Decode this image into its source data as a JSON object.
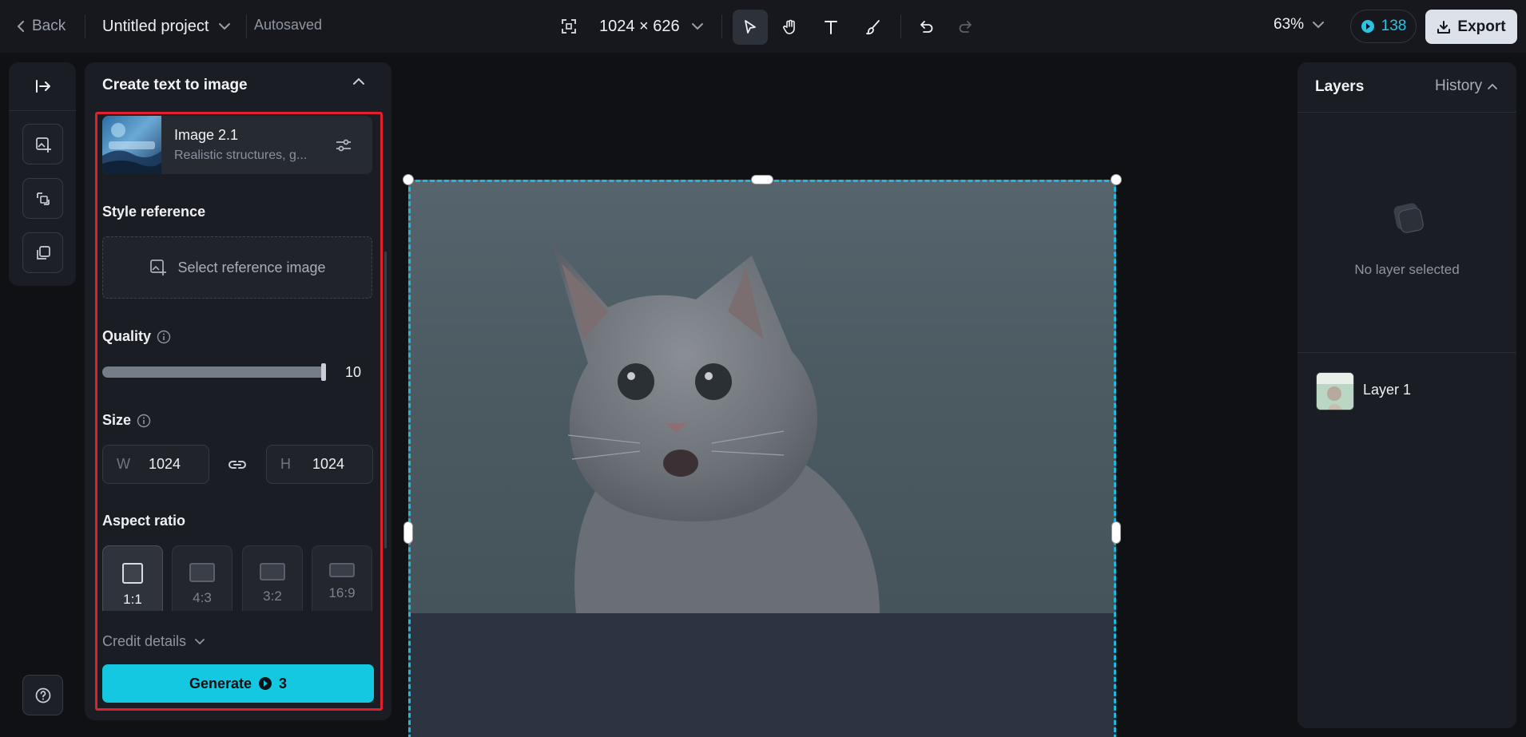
{
  "topbar": {
    "back_label": "Back",
    "project_name": "Untitled project",
    "save_status": "Autosaved",
    "canvas_size": "1024 × 626",
    "zoom": "63%",
    "credits": "138",
    "export_label": "Export"
  },
  "left_panel": {
    "title": "Create text to image",
    "model": {
      "name": "Image 2.1",
      "description": "Realistic structures, g..."
    },
    "style_reference": {
      "label": "Style reference",
      "button": "Select reference image"
    },
    "quality": {
      "label": "Quality",
      "value": "10",
      "fraction": 1.0
    },
    "size": {
      "label": "Size",
      "width_label": "W",
      "width": "1024",
      "height_label": "H",
      "height": "1024"
    },
    "aspect_ratio": {
      "label": "Aspect ratio",
      "options": [
        "1:1",
        "4:3",
        "3:2",
        "16:9"
      ],
      "selected": "1:1"
    },
    "credit_details": "Credit details",
    "generate": {
      "label": "Generate",
      "cost": "3"
    }
  },
  "right_panel": {
    "layers_tab": "Layers",
    "history_tab": "History",
    "empty_state": "No layer selected",
    "layers": [
      {
        "name": "Layer 1"
      }
    ]
  },
  "colors": {
    "accent": "#13c8e0",
    "selection": "#1fb8d8",
    "highlight_frame": "#e2202c"
  }
}
